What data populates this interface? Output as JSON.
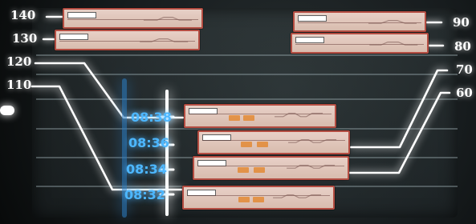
{
  "display": {
    "left_levels": [
      "140",
      "130",
      "120",
      "110"
    ],
    "right_levels": [
      "90",
      "80",
      "70",
      "60"
    ],
    "timeline": [
      "08:38",
      "08:36",
      "08:34",
      "08:32"
    ]
  },
  "colors": {
    "timeline_blue": "#4db7ff",
    "guide_white": "#ffffff",
    "strip_border": "#b44d42",
    "strip_fill": "#d8bcae"
  }
}
